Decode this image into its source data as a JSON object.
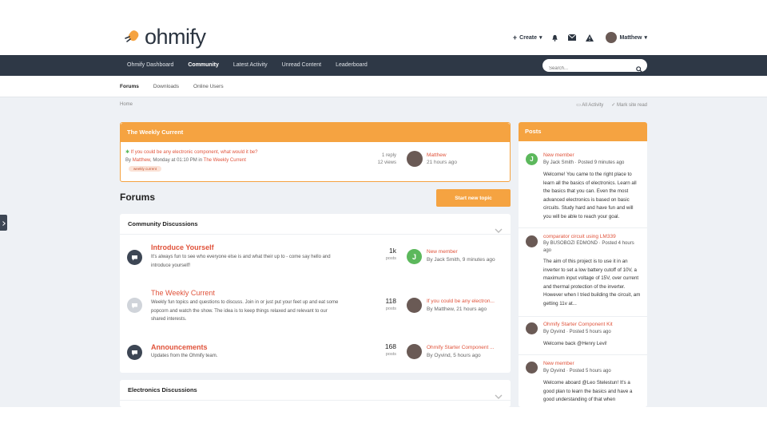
{
  "brand": {
    "name": "ohmify",
    "accent": "#f5a341",
    "link": "#e0533b",
    "nav_bg": "#2e3846"
  },
  "user_bar": {
    "create": "Create",
    "username": "Matthew"
  },
  "nav": {
    "items": [
      "Ohmify Dashboard",
      "Community",
      "Latest Activity",
      "Unread Content",
      "Leaderboard"
    ],
    "active": "Community",
    "search_placeholder": "Search..."
  },
  "subnav": {
    "items": [
      "Forums",
      "Downloads",
      "Online Users"
    ],
    "active": "Forums"
  },
  "breadcrumb": "Home",
  "page_actions": {
    "all_activity": "All Activity",
    "mark_read": "Mark site read"
  },
  "weekly": {
    "title": "The Weekly Current",
    "topic": "If you could be any electronic component, what would it be?",
    "by_prefix": "By",
    "author": "Matthew",
    "when": ", Monday at 01:10 PM in",
    "forum": "The Weekly Current",
    "tag": "weekly current",
    "replies": "1 reply",
    "views": "12 views",
    "last_user": "Matthew",
    "last_time": "21 hours ago"
  },
  "forums": {
    "heading": "Forums",
    "start_topic": "Start new topic",
    "category1": "Community Discussions",
    "category2": "Electronics Discussions",
    "rows": [
      {
        "name": "Introduce Yourself",
        "desc": "It's always fun to see who everyone else is and what their up to - come say hello and introduce yourself!",
        "count": "1k",
        "count_label": "posts",
        "last_title": "New member",
        "last_by": "By Jack Smith, 9 minutes ago",
        "avatar": "J"
      },
      {
        "name": "The Weekly Current",
        "desc": "Weekly fun topics and questions to discuss. Join in or just put your feet up and eat some popcorn and watch the show. The idea is to keep things relaxed and relevant to our shared interests.",
        "count": "118",
        "count_label": "posts",
        "last_title": "If you could be any electron...",
        "last_by": "By Matthew, 21 hours ago",
        "avatar": ""
      },
      {
        "name": "Announcements",
        "desc": "Updates from the Ohmify team.",
        "count": "168",
        "count_label": "posts",
        "last_title": "Ohmify Starter Component ...",
        "last_by": "By Oyvind, 5 hours ago",
        "avatar": ""
      }
    ]
  },
  "posts": {
    "title": "Posts",
    "items": [
      {
        "title": "New member",
        "by": "By Jack Smith · Posted 9 minutes ago",
        "body": "Welcome! You came to the right place to learn all the basics of electronics. Learn all the basics that you can. Even the most advanced electronics is based on basic circuits. Study hard and have fun and will you will be able to reach your goal.",
        "avatar": "J"
      },
      {
        "title": "comparator circuit using LM339",
        "by": "By BUSOBOZI EDMOND · Posted 4 hours ago",
        "body": "The aim of this project is to use it in an inverter to set a low battery cutoff of 10V, a maximum input voltage of 15V, over current and thermal protection of the inverter. However when I tried building the circuit, am getting 11v at...",
        "avatar": ""
      },
      {
        "title": "Ohmify Starter Component Kit",
        "by": "By Oyvind · Posted 5 hours ago",
        "body": "Welcome back @Henry Levi!",
        "avatar": ""
      },
      {
        "title": "New member",
        "by": "By Oyvind · Posted 5 hours ago",
        "body": "Welcome aboard @Leo Stelestun! It's a good plan to learn the basics and have a good understanding of that when",
        "avatar": ""
      }
    ]
  },
  "icons": [
    "logo-bolt-icon",
    "bell-icon",
    "envelope-icon",
    "warning-icon",
    "search-icon",
    "chevron-down-icon",
    "chat-bubble-icon",
    "clock-icon",
    "check-icon",
    "chevron-right-icon"
  ]
}
